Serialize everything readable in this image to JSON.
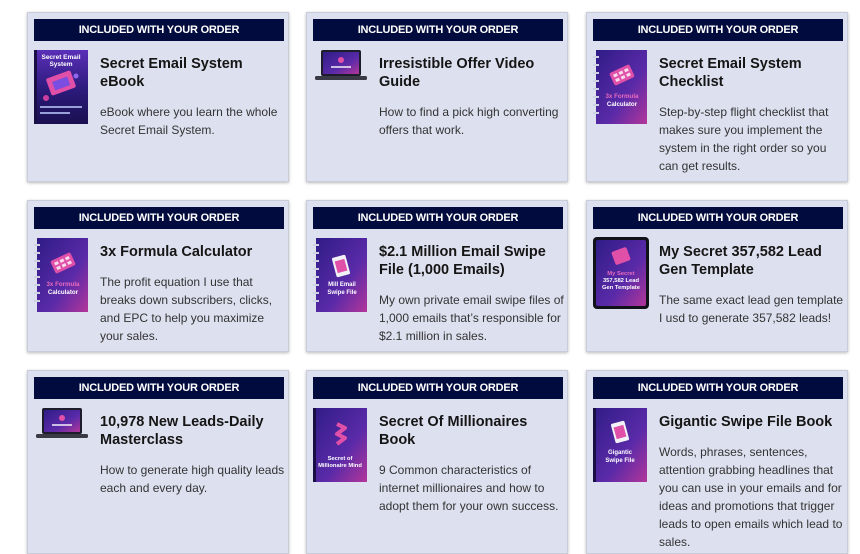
{
  "cards": [
    {
      "badge": "INCLUDED WITH YOUR ORDER",
      "title": "Secret Email System eBook",
      "description": "eBook where you learn the whole Secret Email System.",
      "cover_text": "Secret Email System"
    },
    {
      "badge": "INCLUDED WITH YOUR ORDER",
      "title": "Irresistible Offer Video Guide",
      "description": "How to find a pick high converting offers that work."
    },
    {
      "badge": "INCLUDED WITH YOUR ORDER",
      "title": "Secret Email System Checklist",
      "description": "Step-by-step flight checklist that makes sure you implement the system in the right order so you can get results.",
      "cover_text": "3x Formula Calculator"
    },
    {
      "badge": "INCLUDED WITH YOUR ORDER",
      "title": "3x Formula Calculator",
      "description": "The profit equation I use that breaks down subscribers, clicks, and EPC to help you maximize your sales.",
      "cover_text": "3x Formula Calculator"
    },
    {
      "badge": "INCLUDED WITH YOUR ORDER",
      "title": "$2.1 Million Email Swipe File (1,000 Emails)",
      "description": "My own private email swipe files of 1,000 emails that’s responsible for $2.1 million in sales.",
      "cover_text": "Mill Email Swipe File"
    },
    {
      "badge": "INCLUDED WITH YOUR ORDER",
      "title": "My Secret 357,582 Lead Gen Template",
      "description": "The same exact lead gen template I usd to generate 357,582 leads!",
      "cover_text": "My Secret 357,582 Lead Gen Template"
    },
    {
      "badge": "INCLUDED WITH YOUR ORDER",
      "title": "10,978 New Leads-Daily Masterclass",
      "description": "How to generate high quality leads each and every day."
    },
    {
      "badge": "INCLUDED WITH YOUR ORDER",
      "title": "Secret Of Millionaires Book",
      "description": "9 Common characteristics of internet millionaires and how to adopt them for your own success.",
      "cover_text": "Secret of Millionaire Mind"
    },
    {
      "badge": "INCLUDED WITH YOUR ORDER",
      "title": "Gigantic Swipe File Book",
      "description": "Words, phrases, sentences, attention grabbing headlines that you can use in your emails and for ideas and promotions that trigger leads to open emails which lead to sales.",
      "cover_text": "Gigantic Swipe File"
    }
  ],
  "colors": {
    "card_bg": "#dde1ef",
    "banner_bg": "#020b3d",
    "banner_text": "#ffffff",
    "cover_purple": "#3a1a86",
    "cover_pink": "#c93fa0"
  }
}
